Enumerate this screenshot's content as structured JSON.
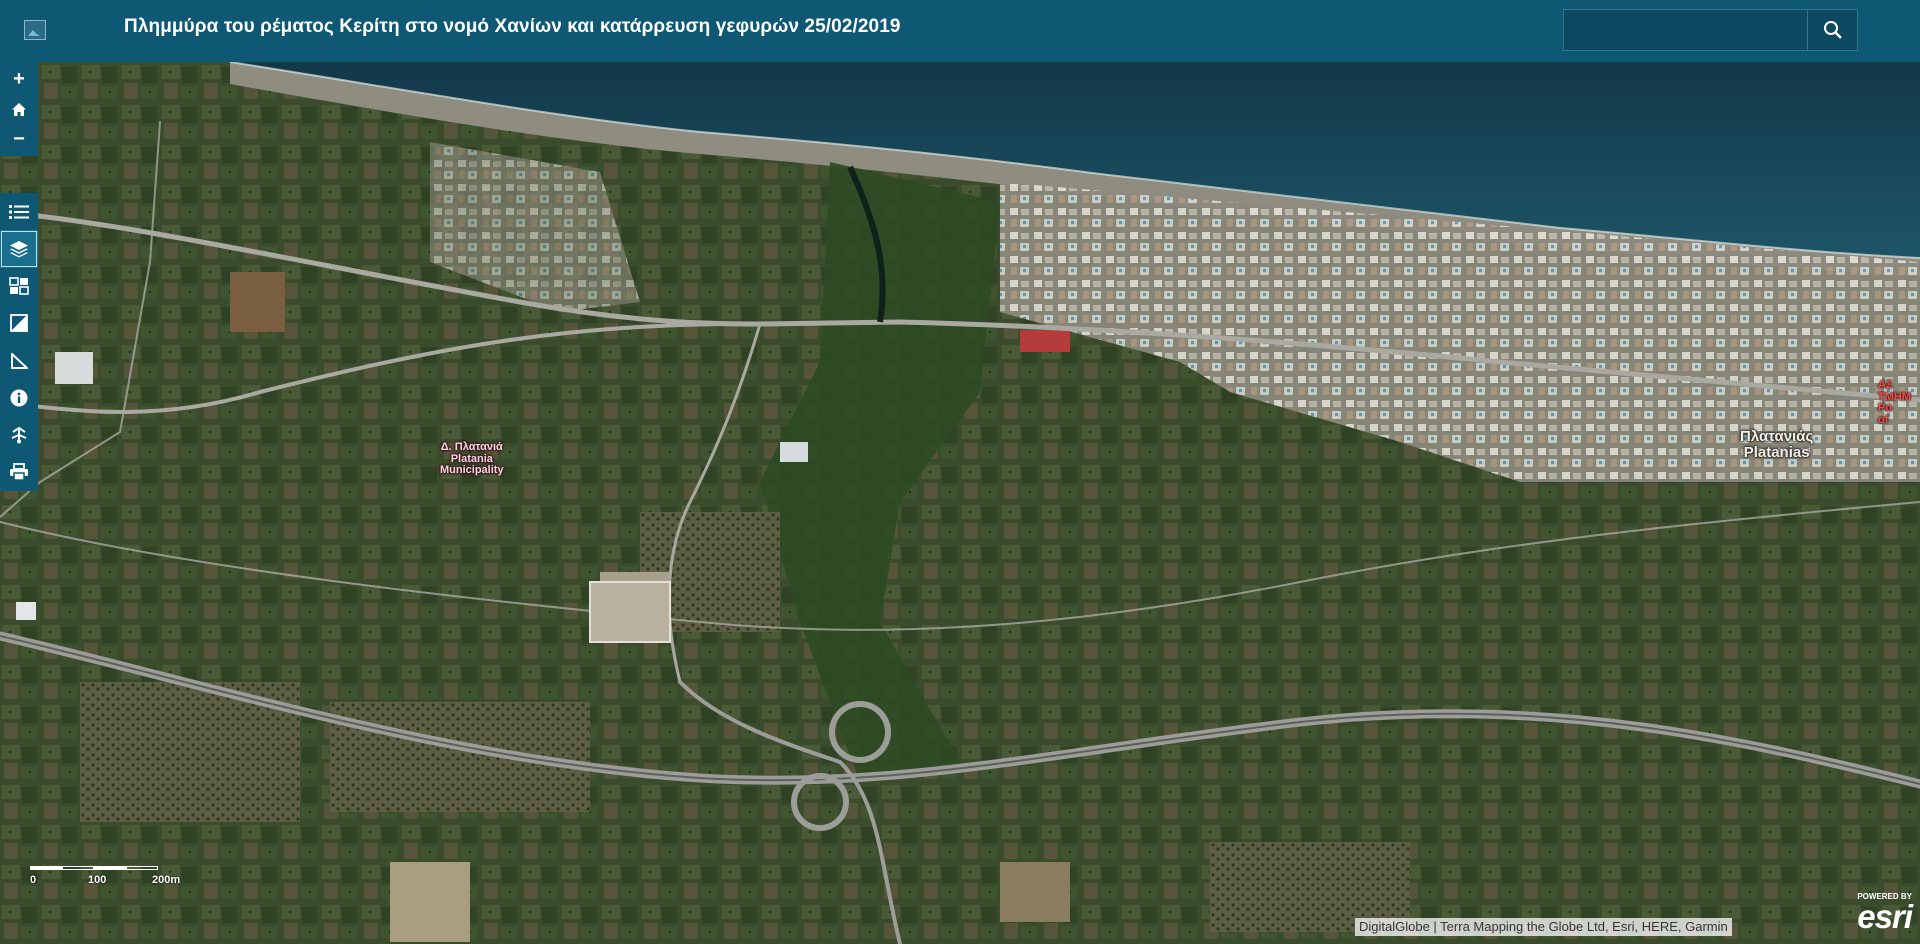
{
  "header": {
    "title": "Πλημμύρα του ρέματος Κερίτη στο νομό Χανίων και κατάρρευση γεφυρών 25/02/2019",
    "logo_icon": "broken-image-icon",
    "search": {
      "placeholder": "",
      "value": "",
      "button_icon": "search-icon"
    }
  },
  "zoom_controls": [
    {
      "name": "zoom-in-button",
      "icon": "plus-icon",
      "label": "+"
    },
    {
      "name": "home-button",
      "icon": "home-icon",
      "label": ""
    },
    {
      "name": "zoom-out-button",
      "icon": "minus-icon",
      "label": "−"
    }
  ],
  "toolbar": [
    {
      "name": "legend-button",
      "icon": "list-icon",
      "active": false
    },
    {
      "name": "layers-button",
      "icon": "layers-icon",
      "active": true
    },
    {
      "name": "basemap-gallery-button",
      "icon": "basemap-icon",
      "active": false
    },
    {
      "name": "swipe-button",
      "icon": "swipe-icon",
      "active": false
    },
    {
      "name": "measure-button",
      "icon": "measure-icon",
      "active": false
    },
    {
      "name": "about-button",
      "icon": "info-icon",
      "active": false
    },
    {
      "name": "share-button",
      "icon": "share-icon",
      "active": false
    },
    {
      "name": "print-button",
      "icon": "print-icon",
      "active": false
    }
  ],
  "map_labels": {
    "municipality": {
      "line1": "Δ. Πλατανιά",
      "line2": "Platania",
      "line3": "Municipality"
    },
    "town": {
      "line1": "Πλατανιάς",
      "line2": "Platanias"
    },
    "edge": {
      "line1": "ΑΣ",
      "line2": "ΤΜΗΜ",
      "line3": "Ρο",
      "line4": "of"
    }
  },
  "scalebar": {
    "labels": [
      "0",
      "100",
      "200m"
    ]
  },
  "attribution": "DigitalGlobe | Terra Mapping the Globe Ltd, Esri, HERE, Garmin",
  "esri": {
    "powered": "POWERED BY",
    "word": "esri"
  },
  "colors": {
    "header": "#0f5873",
    "sea": "#16414f",
    "land": "#34472a"
  }
}
